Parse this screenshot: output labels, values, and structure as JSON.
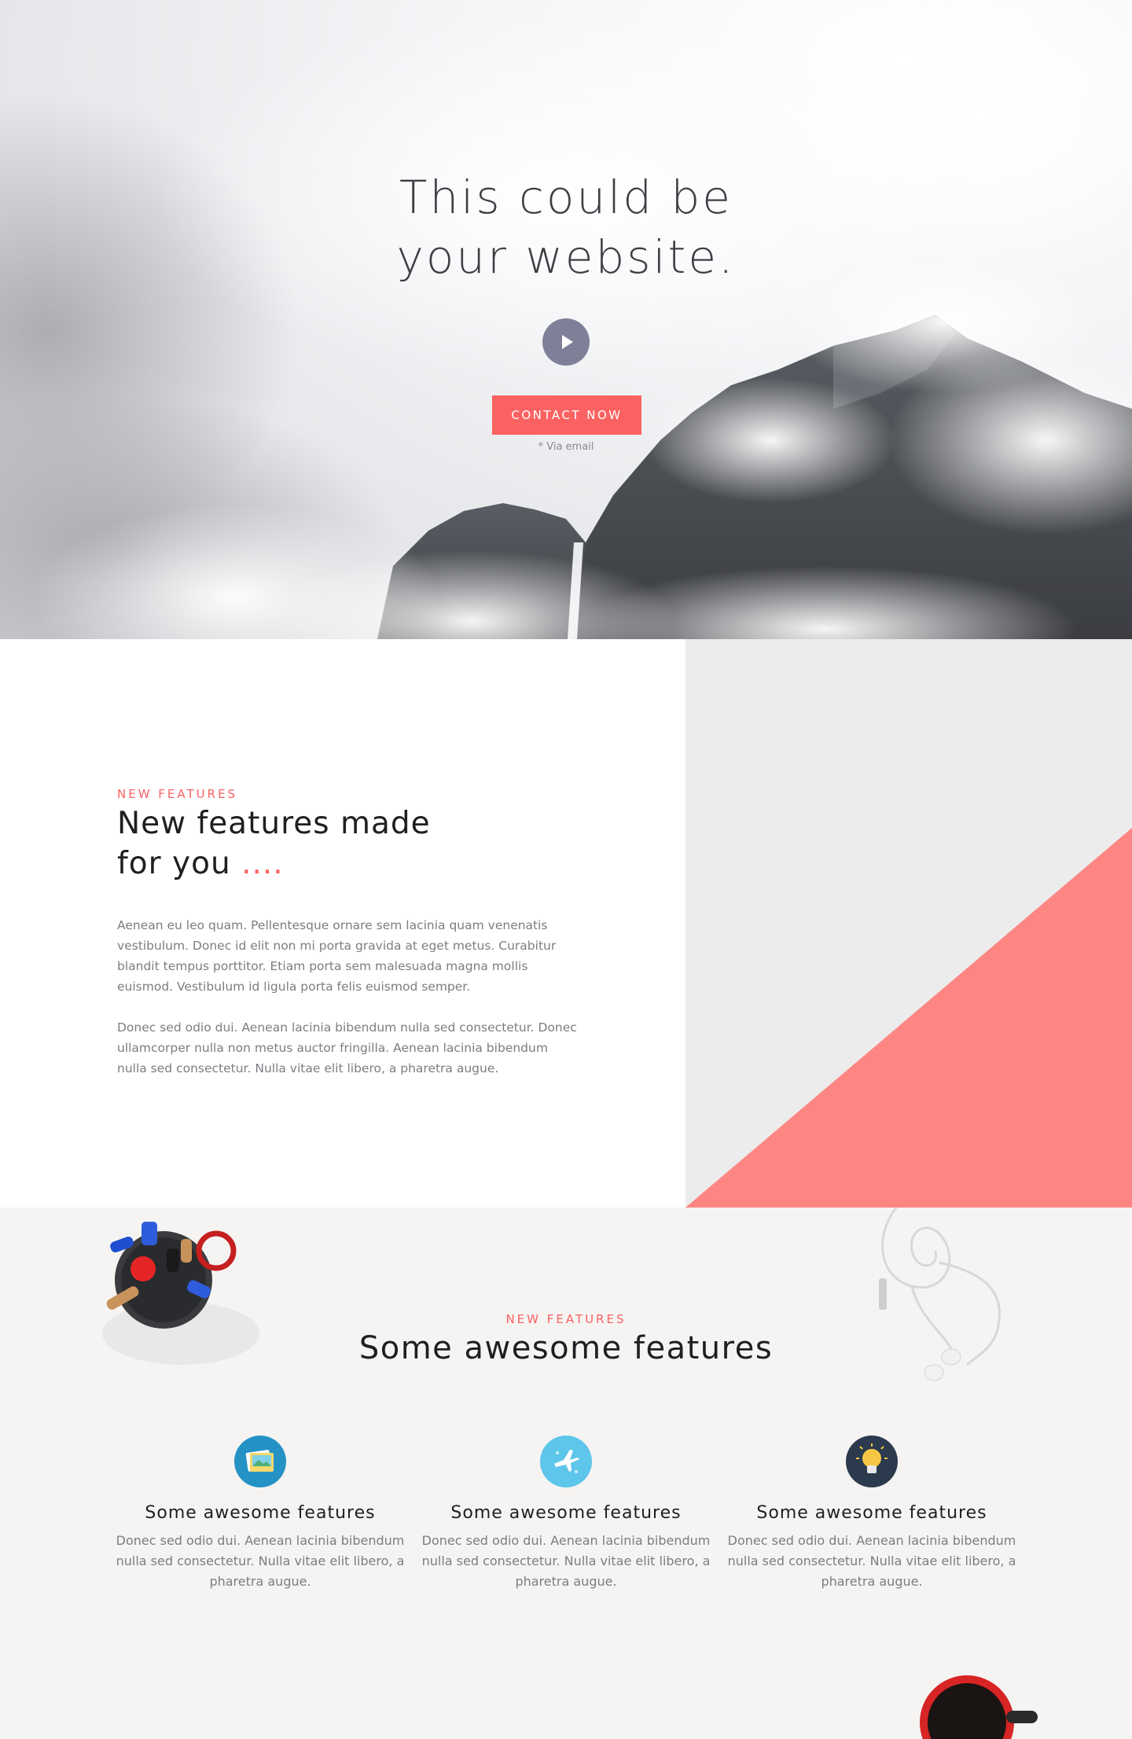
{
  "hero": {
    "title_line1": "This could be",
    "title_line2": "your website.",
    "cta_label": "CONTACT NOW",
    "note": "* Via email"
  },
  "intro": {
    "eyebrow": "NEW FEATURES",
    "heading_line1": "New features made",
    "heading_line2": "for you",
    "heading_accent": "....",
    "paragraph1": "Aenean eu leo quam. Pellentesque ornare sem lacinia quam venenatis vestibulum. Donec id elit non mi porta gravida at eget metus. Curabitur blandit tempus porttitor. Etiam porta sem malesuada magna mollis euismod. Vestibulum id ligula porta felis euismod semper.",
    "paragraph2": "Donec sed odio dui. Aenean lacinia bibendum nulla sed consectetur. Donec ullamcorper nulla non metus auctor fringilla. Aenean lacinia bibendum nulla sed consectetur. Nulla vitae elit libero, a pharetra augue."
  },
  "features_section": {
    "eyebrow": "NEW FEATURES",
    "title": "Some awesome features",
    "items": [
      {
        "icon": "image-icon",
        "title": "Some awesome features",
        "text": "Donec sed odio dui. Aenean lacinia bibendum nulla sed consectetur. Nulla vitae elit libero, a pharetra augue."
      },
      {
        "icon": "airplane-icon",
        "title": "Some awesome features",
        "text": "Donec sed odio dui. Aenean lacinia bibendum nulla sed consectetur. Nulla vitae elit libero, a pharetra augue."
      },
      {
        "icon": "lightbulb-icon",
        "title": "Some awesome features",
        "text": "Donec sed odio dui. Aenean lacinia bibendum nulla sed consectetur. Nulla vitae elit libero, a pharetra augue."
      }
    ]
  },
  "colors": {
    "accent": "#fa6262",
    "triangle": "#fd8683",
    "play_button": "#7f8098",
    "panel_grey": "#ececec"
  }
}
